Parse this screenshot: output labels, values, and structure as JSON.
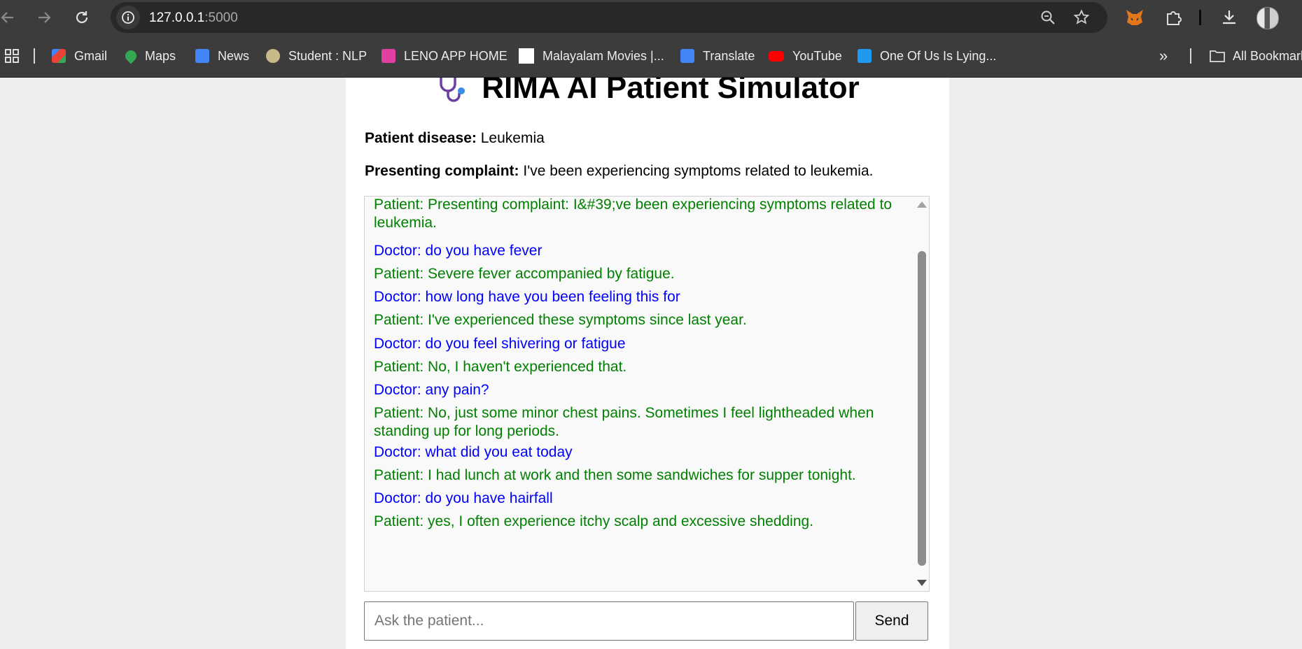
{
  "browser": {
    "url_host": "127.0.0.1",
    "url_port": ":5000"
  },
  "bookmarks": [
    {
      "label": "Gmail",
      "icon": "gmail-icon",
      "color": "#ea4335"
    },
    {
      "label": "Maps",
      "icon": "maps-icon",
      "color": "#34a853"
    },
    {
      "label": "News",
      "icon": "news-icon",
      "color": "#4285f4"
    },
    {
      "label": "Student : NLP",
      "icon": "student-icon",
      "color": "#c8b98a"
    },
    {
      "label": "LENO APP HOME",
      "icon": "leno-icon",
      "color": "#e040a0"
    },
    {
      "label": "Malayalam Movies |...",
      "icon": "page-icon",
      "color": "#ffffff"
    },
    {
      "label": "Translate",
      "icon": "translate-icon",
      "color": "#4285f4"
    },
    {
      "label": "YouTube",
      "icon": "youtube-icon",
      "color": "#ff0000"
    },
    {
      "label": "One Of Us Is Lying...",
      "icon": "tvshow-icon",
      "color": "#1e9bf0"
    }
  ],
  "all_bookmarks_label": "All Bookmarks",
  "page": {
    "title": "RIMA AI Patient Simulator",
    "disease_label": "Patient disease:",
    "disease_value": "Leukemia",
    "complaint_label": "Presenting complaint:",
    "complaint_value": "I've been experiencing symptoms related to leukemia."
  },
  "messages": [
    {
      "role": "patient",
      "text": "Patient: Presenting complaint: I&#39;ve been experiencing symptoms related to leukemia."
    },
    {
      "role": "doctor",
      "text": "Doctor: do you have fever"
    },
    {
      "role": "patient",
      "text": "Patient: Severe fever accompanied by fatigue."
    },
    {
      "role": "doctor",
      "text": "Doctor: how long have you been feeling this for"
    },
    {
      "role": "patient",
      "text": "Patient: I've experienced these symptoms since last year."
    },
    {
      "role": "doctor",
      "text": "Doctor: do you feel shivering or fatigue"
    },
    {
      "role": "patient",
      "text": "Patient: No, I haven't experienced that."
    },
    {
      "role": "doctor",
      "text": "Doctor: any pain?"
    },
    {
      "role": "patient",
      "text": "Patient: No, just some minor chest pains. Sometimes I feel lightheaded when standing up for long periods."
    },
    {
      "role": "doctor",
      "text": "Doctor: what did you eat today"
    },
    {
      "role": "patient",
      "text": "Patient: I had lunch at work and then some sandwiches for supper tonight."
    },
    {
      "role": "doctor",
      "text": "Doctor: do you have hairfall"
    },
    {
      "role": "patient",
      "text": "Patient: yes, I often experience itchy scalp and excessive shedding."
    }
  ],
  "input": {
    "placeholder": "Ask the patient...",
    "value": ""
  },
  "send_label": "Send",
  "colors": {
    "patient": "#008000",
    "doctor": "#0000ff"
  }
}
